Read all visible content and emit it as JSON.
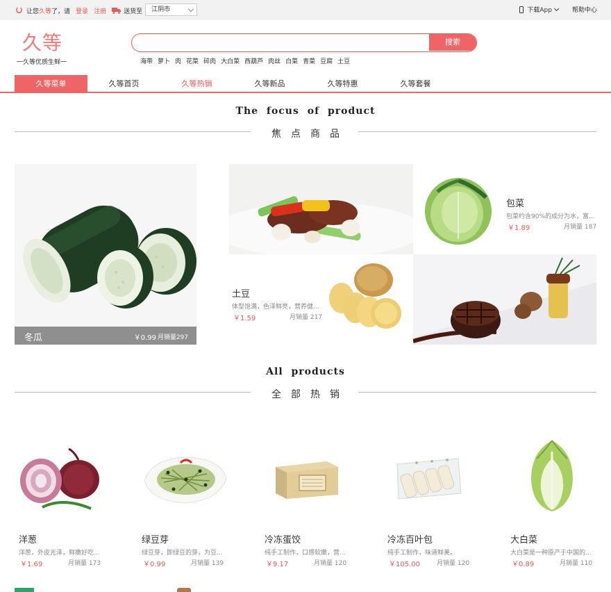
{
  "topbar": {
    "greeting_prefix": "让您",
    "brand": "久等",
    "greeting_suffix": "了，请",
    "login": "登录",
    "register": "注册",
    "ship_to": "送货至",
    "city": "江阴市",
    "download_app": "下载App",
    "help": "帮助中心"
  },
  "header": {
    "logo": "久等",
    "slogan": "一久等优质生鲜一",
    "search_placeholder": "",
    "search_button": "搜索",
    "hot_words": [
      "海带",
      "萝卜",
      "肉",
      "花菜",
      "碎肉",
      "大白菜",
      "西葫芦",
      "肉丝",
      "白菜",
      "青菜",
      "豆腐",
      "土豆"
    ]
  },
  "nav": [
    {
      "label": "久等菜单",
      "state": "active"
    },
    {
      "label": "久等首页",
      "state": "normal"
    },
    {
      "label": "久等热销",
      "state": "highlight"
    },
    {
      "label": "久等新品",
      "state": "normal"
    },
    {
      "label": "久等特惠",
      "state": "normal"
    },
    {
      "label": "久等套餐",
      "state": "normal"
    }
  ],
  "focus_section": {
    "title_en": "The focus of product",
    "title_zh": "焦点商品"
  },
  "focus": {
    "big": {
      "name": "冬瓜",
      "price": "￥0.99",
      "sales": "月销量297"
    },
    "cabbage": {
      "name": "包菜",
      "desc": "包菜约含90%的成分为水，富...",
      "price": "￥1.89",
      "sales": "月销量 187"
    },
    "potato": {
      "name": "土豆",
      "desc": "体型饱满，色泽鲜亮，营养健...",
      "price": "￥1.59",
      "sales": "月销量 217"
    }
  },
  "all_section": {
    "title_en": "All products",
    "title_zh": "全部热销"
  },
  "products": [
    {
      "name": "洋葱",
      "desc": "洋葱，外皮光泽，鲜嫩好吃...",
      "price": "￥1.69",
      "sales": "月销量 173",
      "icon": "onion"
    },
    {
      "name": "绿豆芽",
      "desc": "绿豆芽，即绿豆的芽，为豆...",
      "price": "￥0.99",
      "sales": "月销量 139",
      "icon": "bean-sprouts"
    },
    {
      "name": "冷冻蛋饺",
      "desc": "纯手工制作，口感软嫩，营...",
      "price": "￥9.17",
      "sales": "月销量 120",
      "icon": "box"
    },
    {
      "name": "冷冻百叶包",
      "desc": "纯手工制作，味道鲜美。",
      "price": "￥105.00",
      "sales": "月销量 120",
      "icon": "rolls"
    },
    {
      "name": "大白菜",
      "desc": "大白菜是一种原产于中国的...",
      "price": "￥0.89",
      "sales": "月销量 110",
      "icon": "napa-cabbage"
    }
  ],
  "colors": {
    "accent": "#ef6464",
    "price": "#e85a5a"
  }
}
